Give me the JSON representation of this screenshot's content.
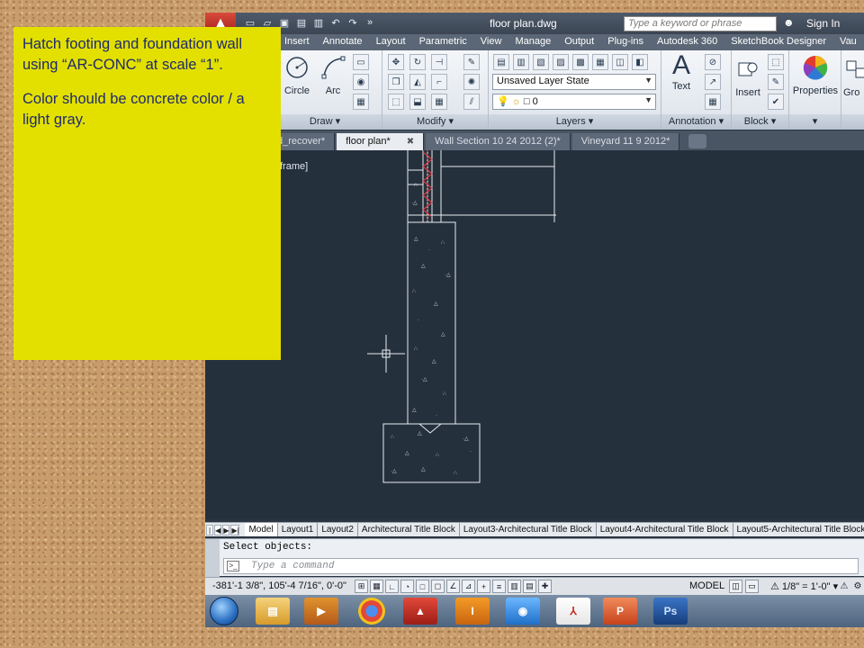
{
  "note": {
    "line1": "Hatch footing and foundation wall using “AR-CONC” at scale “1”.",
    "line2": "Color should be concrete color / a light gray."
  },
  "titlebar": {
    "title": "floor plan.dwg",
    "search_placeholder": "Type a keyword or phrase",
    "sign_in": "Sign In"
  },
  "ribbon_tabs": [
    "Insert",
    "Annotate",
    "Layout",
    "Parametric",
    "View",
    "Manage",
    "Output",
    "Plug-ins",
    "Autodesk 360",
    "SketchBook Designer",
    "Vau"
  ],
  "ribbon": {
    "draw": {
      "title": "Draw",
      "circle": "Circle",
      "arc": "Arc"
    },
    "modify": {
      "title": "Modify"
    },
    "layers": {
      "title": "Layers",
      "layer_state": "Unsaved Layer State",
      "current_layer": "0"
    },
    "annotation": {
      "title": "Annotation",
      "text": "Text"
    },
    "block": {
      "title": "Block",
      "insert": "Insert"
    },
    "properties": {
      "label": "Properties"
    },
    "groups": {
      "label": "Gro"
    }
  },
  "file_tabs": [
    {
      "label": "d_recover*",
      "active": false
    },
    {
      "label": "floor plan*",
      "active": true
    },
    {
      "label": "Wall Section 10 24 2012 (2)*",
      "active": false
    },
    {
      "label": "Vineyard 11 9 2012*",
      "active": false
    }
  ],
  "viewport": {
    "label": "frame]"
  },
  "layout_tabs": [
    "Model",
    "Layout1",
    "Layout2",
    "Architectural Title Block",
    "Layout3-Architectural Title Block",
    "Layout4-Architectural Title Block",
    "Layout5-Architectural Title Block"
  ],
  "command": {
    "history": "Select objects:",
    "placeholder": "Type a command"
  },
  "status": {
    "coords": "-381'-1 3/8\", 105'-4 7/16\", 0'-0\"",
    "model": "MODEL",
    "scale": "1/8\" = 1'-0\""
  },
  "taskbar_apps": [
    {
      "name": "explorer-icon",
      "label": ""
    },
    {
      "name": "media-player-icon",
      "label": ""
    },
    {
      "name": "chrome-icon",
      "label": ""
    },
    {
      "name": "autocad-icon",
      "label": ""
    },
    {
      "name": "inventor-icon",
      "label": "I"
    },
    {
      "name": "eye-app-icon",
      "label": ""
    },
    {
      "name": "acrobat-icon",
      "label": ""
    },
    {
      "name": "powerpoint-icon",
      "label": "P"
    },
    {
      "name": "photoshop-icon",
      "label": "Ps"
    }
  ],
  "colors": {
    "note_bg": "#e3e000",
    "note_text": "#1e2a6e",
    "viewport_bg": "#25303d",
    "cork": "#c99c6c"
  }
}
